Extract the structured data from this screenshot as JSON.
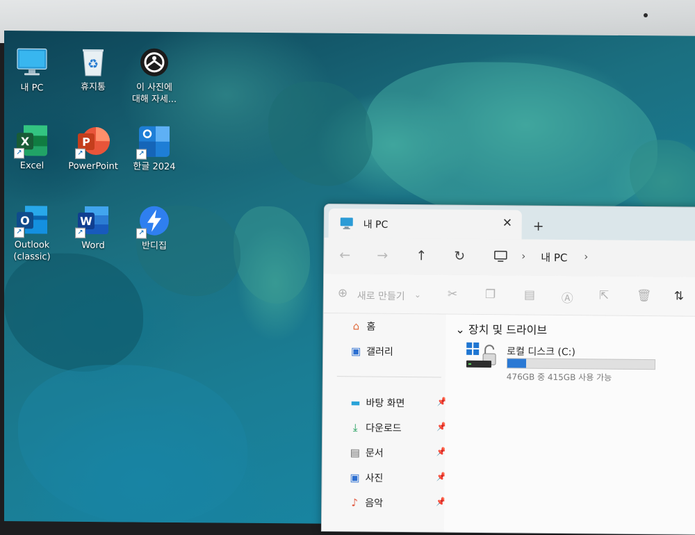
{
  "desktop": {
    "icons": [
      {
        "label": "내 PC",
        "icon": "computer-icon"
      },
      {
        "label": "휴지통",
        "icon": "recycle-bin-icon"
      },
      {
        "label_line1": "이 사진에",
        "label_line2": "대해 자세...",
        "icon": "learn-about-picture-icon"
      },
      {
        "label": "Excel",
        "icon": "excel-icon"
      },
      {
        "label": "PowerPoint",
        "icon": "powerpoint-icon"
      },
      {
        "label": "한글 2024",
        "icon": "hangul-icon"
      },
      {
        "label_line1": "Outlook",
        "label_line2": "(classic)",
        "icon": "outlook-icon"
      },
      {
        "label": "Word",
        "icon": "word-icon"
      },
      {
        "label": "반디집",
        "icon": "bandizip-icon"
      }
    ]
  },
  "explorer": {
    "tab_title": "내 PC",
    "tab_close": "✕",
    "tab_add": "+",
    "breadcrumb": {
      "item": "내 PC",
      "sep": "›"
    },
    "toolbar": {
      "new_label": "새로 만들기"
    },
    "sidebar": {
      "items": [
        {
          "label": "홈",
          "icon": "home-icon"
        },
        {
          "label": "갤러리",
          "icon": "gallery-icon"
        },
        {
          "label": "바탕 화면",
          "icon": "desktop-folder-icon",
          "pinned": true
        },
        {
          "label": "다운로드",
          "icon": "download-icon",
          "pinned": true
        },
        {
          "label": "문서",
          "icon": "documents-icon",
          "pinned": true
        },
        {
          "label": "사진",
          "icon": "pictures-icon",
          "pinned": true
        },
        {
          "label": "음악",
          "icon": "music-icon",
          "pinned": true
        }
      ]
    },
    "content": {
      "section_title": "장치 및 드라이브",
      "drives": [
        {
          "name": "로컬 디스크 (C:)",
          "info": "476GB 중 415GB 사용 가능",
          "used_fraction": 0.128,
          "bar_color": "#2a79d4"
        }
      ]
    }
  }
}
